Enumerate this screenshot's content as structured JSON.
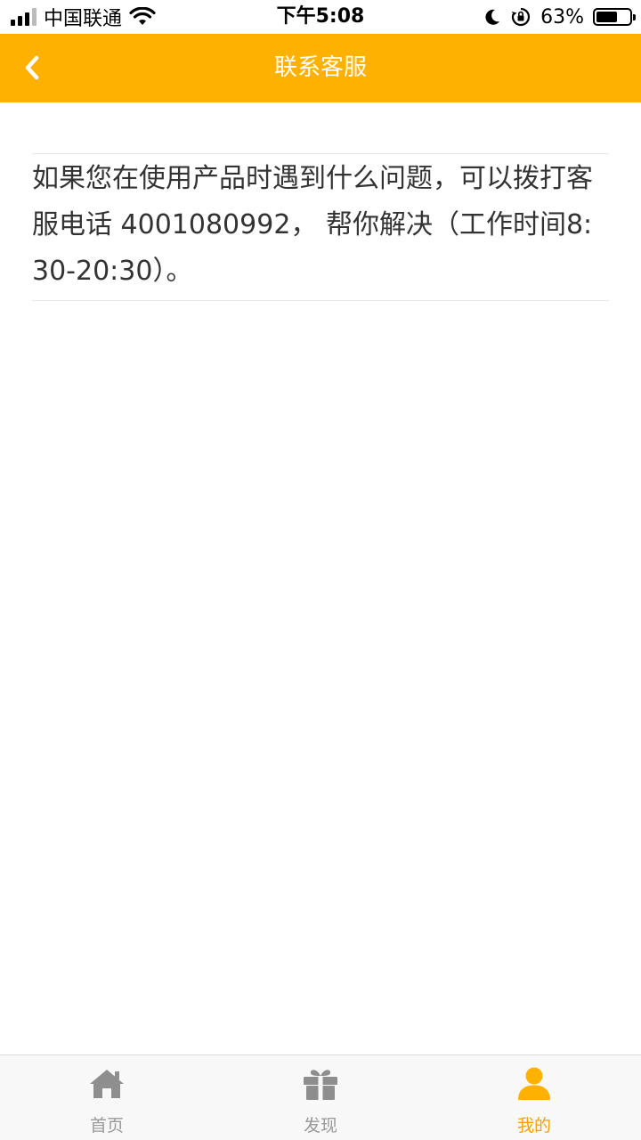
{
  "status_bar": {
    "carrier": "中国联通",
    "time": "下午5:08",
    "battery_percent_text": "63%",
    "battery_level": 0.63,
    "icons": [
      "signal-icon",
      "wifi-icon",
      "moon-icon",
      "orientation-lock-icon",
      "battery-icon"
    ]
  },
  "nav": {
    "title": "联系客服",
    "back_icon": "chevron-left-icon"
  },
  "content": {
    "text": "如果您在使用产品时遇到什么问题，可以拨打客服电话 4001080992， 帮你解决（工作时间8:30-20:30）。"
  },
  "tabs": [
    {
      "label": "首页",
      "icon": "home-icon",
      "active": false
    },
    {
      "label": "发现",
      "icon": "gift-icon",
      "active": false
    },
    {
      "label": "我的",
      "icon": "user-icon",
      "active": true
    }
  ],
  "colors": {
    "accent": "#FFB100",
    "active_tab": "#F5A300",
    "inactive_tab": "#999999",
    "body_text": "#333333"
  }
}
